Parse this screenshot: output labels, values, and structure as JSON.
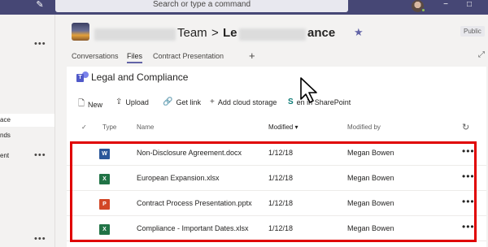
{
  "topbar": {
    "search_placeholder": "Search or type a command",
    "minimize": "−",
    "maximize": "□"
  },
  "sidebar": {
    "more": "•••",
    "items": [
      {
        "label": "ace"
      },
      {
        "label": "nds"
      },
      {
        "label": "ent"
      }
    ]
  },
  "header": {
    "team_suffix": "Team",
    "chevron": ">",
    "channel_start": "Le",
    "channel_end": "ance",
    "badge": "Public"
  },
  "tabs": [
    {
      "label": "Conversations"
    },
    {
      "label": "Files"
    },
    {
      "label": "Contract Presentation"
    }
  ],
  "tab_add": "+",
  "library": {
    "title": "Legal and Compliance",
    "icon_letter": "T"
  },
  "toolbar": {
    "new": "New",
    "upload": "Upload",
    "get_link": "Get link",
    "add_cloud": "Add cloud storage",
    "open_sp": "Open in SharePoint",
    "open_sp_visible": "en in SharePoint"
  },
  "columns": {
    "type": "Type",
    "name": "Name",
    "modified": "Modified ▾",
    "modified_by": "Modified by"
  },
  "files": [
    {
      "type": "word",
      "letter": "W",
      "color": "#2b579a",
      "name": "Non-Disclosure Agreement.docx",
      "modified": "1/12/18",
      "modified_by": "Megan Bowen"
    },
    {
      "type": "excel",
      "letter": "X",
      "color": "#217346",
      "name": "European Expansion.xlsx",
      "modified": "1/12/18",
      "modified_by": "Megan Bowen"
    },
    {
      "type": "powerpoint",
      "letter": "P",
      "color": "#d24726",
      "name": "Contract Process Presentation.pptx",
      "modified": "1/12/18",
      "modified_by": "Megan Bowen"
    },
    {
      "type": "excel",
      "letter": "X",
      "color": "#217346",
      "name": "Compliance - Important Dates.xlsx",
      "modified": "1/12/18",
      "modified_by": "Megan Bowen"
    }
  ],
  "row_more": "•••",
  "colors": {
    "accent": "#6264a7",
    "titlebar": "#464775",
    "highlight": "#e00000"
  }
}
